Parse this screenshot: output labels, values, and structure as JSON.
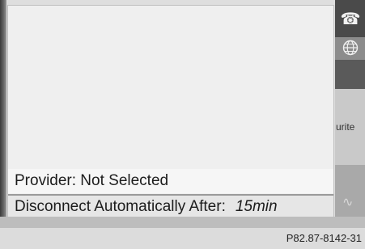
{
  "panel": {
    "provider_row": {
      "text": "Provider: Not Selected"
    },
    "disconnect_row": {
      "label": "Disconnect Automatically After:",
      "value": "15min"
    }
  },
  "side_menu": {
    "phone_icon": "phone-icon",
    "globe_icon": "globe-icon",
    "favourite_fragment": "urite",
    "map_icon": "map-icon"
  },
  "footer": {
    "reference": "P82.87-8142-31"
  }
}
